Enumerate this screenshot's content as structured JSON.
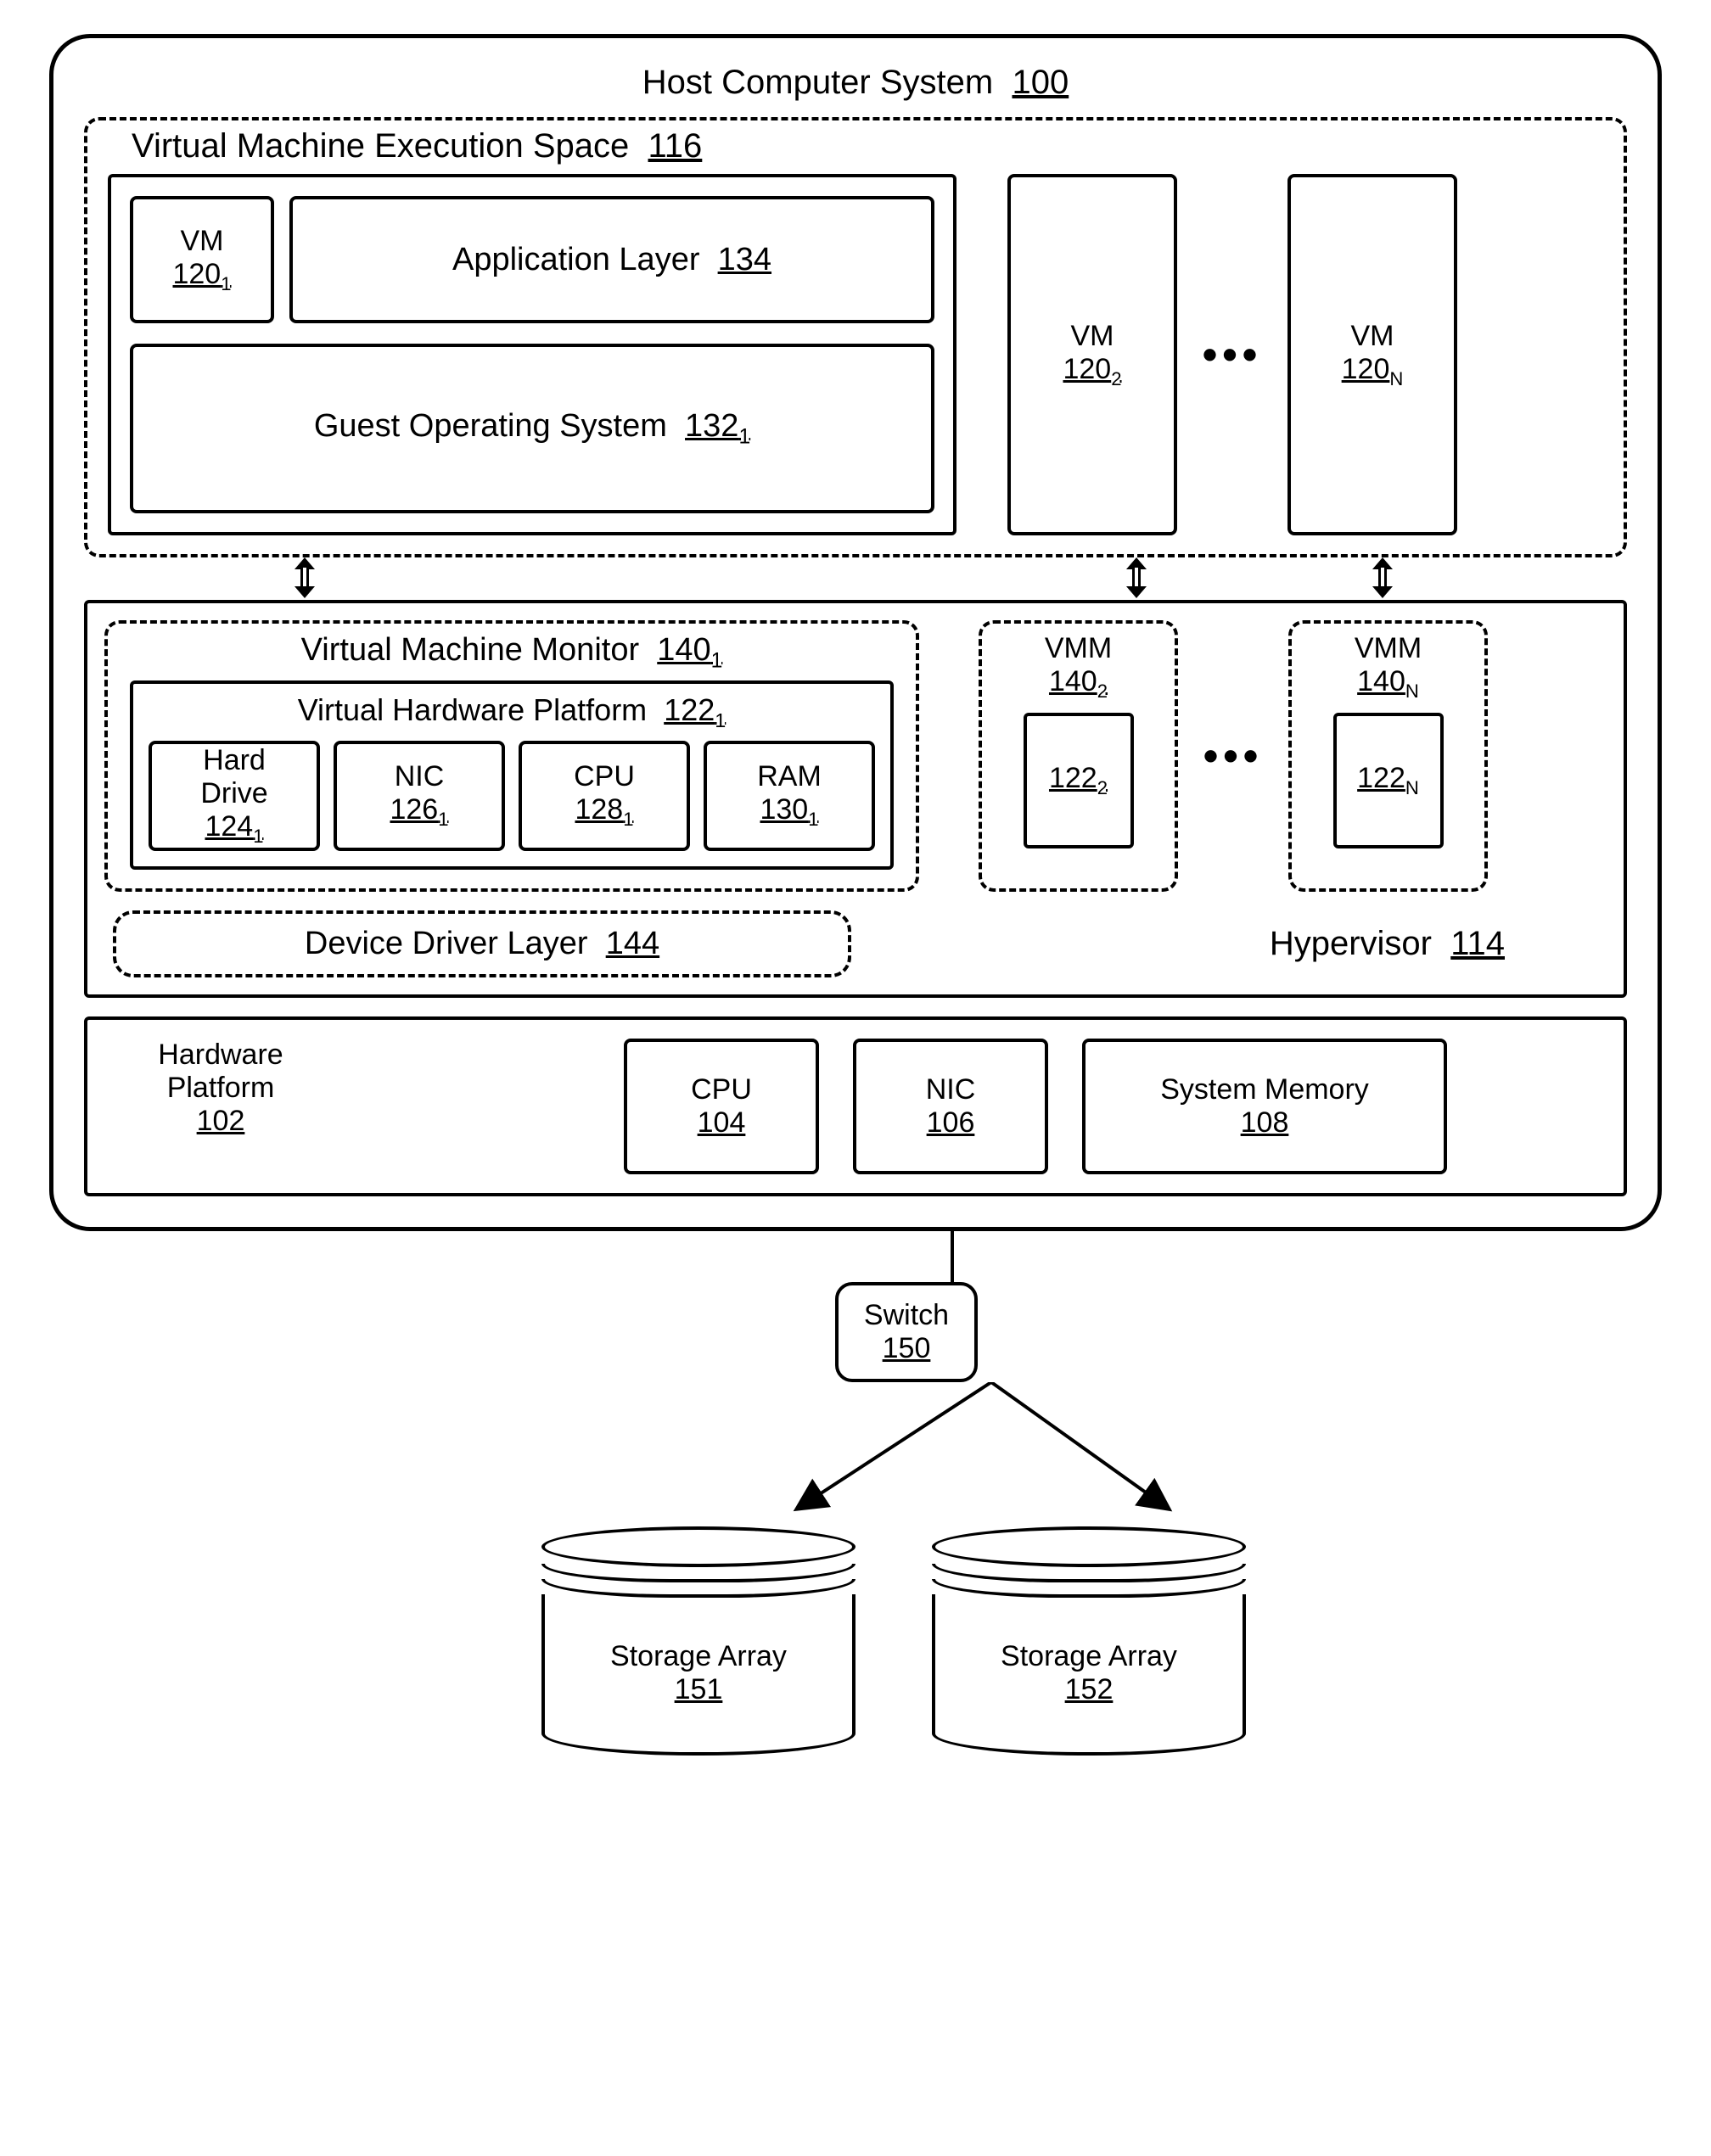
{
  "host": {
    "label": "Host Computer System",
    "ref": "100"
  },
  "vmexec": {
    "label": "Virtual Machine Execution Space",
    "ref": "116"
  },
  "vm1": {
    "label": "VM",
    "ref": "120",
    "sub": "1"
  },
  "app_layer": {
    "label": "Application Layer",
    "ref": "134"
  },
  "guest_os": {
    "label": "Guest Operating System",
    "ref": "132",
    "sub": "1"
  },
  "vm2": {
    "label": "VM",
    "ref": "120",
    "sub": "2"
  },
  "vmN": {
    "label": "VM",
    "ref": "120",
    "sub": "N"
  },
  "dots": "•••",
  "vmm1": {
    "label": "Virtual Machine Monitor",
    "ref": "140",
    "sub": "1"
  },
  "vhp": {
    "label": "Virtual Hardware Platform",
    "ref": "122",
    "sub": "1"
  },
  "hd": {
    "label": "Hard Drive",
    "ref": "124",
    "sub": "1"
  },
  "nic_v": {
    "label": "NIC",
    "ref": "126",
    "sub": "1"
  },
  "cpu_v": {
    "label": "CPU",
    "ref": "128",
    "sub": "1"
  },
  "ram_v": {
    "label": "RAM",
    "ref": "130",
    "sub": "1"
  },
  "vmm2": {
    "label": "VMM",
    "ref": "140",
    "sub": "2",
    "inner_ref": "122",
    "inner_sub": "2"
  },
  "vmmN": {
    "label": "VMM",
    "ref": "140",
    "sub": "N",
    "inner_ref": "122",
    "inner_sub": "N"
  },
  "ddl": {
    "label": "Device Driver Layer",
    "ref": "144"
  },
  "hypervisor": {
    "label": "Hypervisor",
    "ref": "114"
  },
  "hw_platform": {
    "label": "Hardware Platform",
    "ref": "102"
  },
  "cpu": {
    "label": "CPU",
    "ref": "104"
  },
  "nic": {
    "label": "NIC",
    "ref": "106"
  },
  "sysmem": {
    "label": "System Memory",
    "ref": "108"
  },
  "switch": {
    "label": "Switch",
    "ref": "150"
  },
  "sa1": {
    "label": "Storage Array",
    "ref": "151"
  },
  "sa2": {
    "label": "Storage Array",
    "ref": "152"
  }
}
